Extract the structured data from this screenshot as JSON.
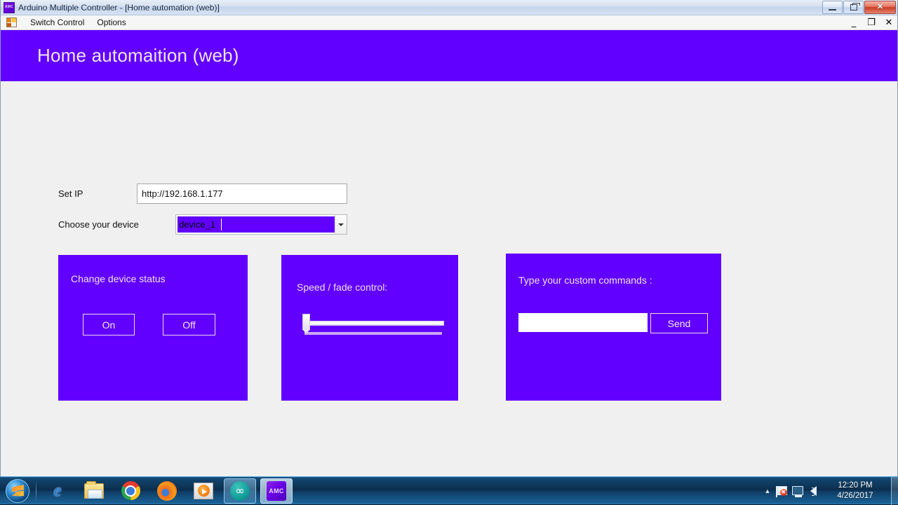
{
  "window": {
    "title": "Arduino Multiple Controller - [Home automation (web)]",
    "app_icon_label": "AMC",
    "controls": {
      "minimize": "–",
      "maximize": "□",
      "close": "✕"
    }
  },
  "menubar": {
    "icon": "switch-control-icon",
    "items": [
      {
        "label": "Switch Control"
      },
      {
        "label": "Options"
      }
    ],
    "mdi_controls": {
      "minimize": "_",
      "restore": "❐",
      "close": "✕"
    }
  },
  "banner": {
    "title": "Home automaition (web)",
    "color": "#6200ff"
  },
  "form": {
    "ip": {
      "label": "Set IP",
      "value": "http://192.168.1.177",
      "placeholder": ""
    },
    "device": {
      "label": "Choose your device",
      "selected": "device_1",
      "options": [
        "device_1"
      ],
      "arrow": "chevron-down-icon"
    }
  },
  "panels": {
    "status": {
      "title": "Change device status",
      "on_label": "On",
      "off_label": "Off"
    },
    "speed": {
      "title": "Speed / fade control:",
      "slider_value": 0,
      "slider_min": 0,
      "slider_max": 100
    },
    "custom": {
      "title": "Type your custom commands :",
      "input_value": "",
      "input_placeholder": "",
      "send_label": "Send"
    }
  },
  "taskbar": {
    "start_label": "start-orb",
    "items": [
      {
        "name": "internet-explorer",
        "glyph": "e"
      },
      {
        "name": "windows-explorer",
        "glyph": ""
      },
      {
        "name": "google-chrome",
        "glyph": ""
      },
      {
        "name": "mozilla-firefox",
        "glyph": ""
      },
      {
        "name": "windows-media-player",
        "glyph": ""
      },
      {
        "name": "arduino-ide",
        "glyph": "∞"
      },
      {
        "name": "arduino-multiple-controller",
        "glyph": "AMC"
      }
    ],
    "tray": {
      "overflow_arrow": "▲",
      "action_center": "✕",
      "icons": [
        "action-center-icon",
        "network-icon",
        "volume-icon"
      ]
    },
    "clock": {
      "time": "12:20 PM",
      "date": "4/26/2017"
    }
  }
}
